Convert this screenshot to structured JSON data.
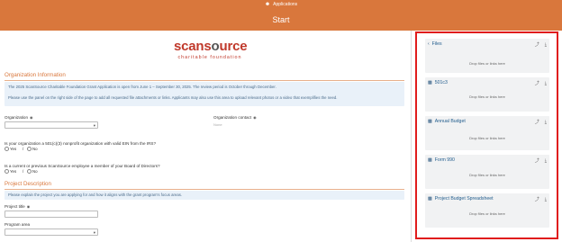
{
  "header": {
    "nav_icon": "users-icon",
    "nav_label": "Applications",
    "title": "Start"
  },
  "logo": {
    "main_part1": "scans",
    "main_o": "o",
    "main_part2": "urce",
    "sub": "charitable foundation"
  },
  "org_info": {
    "title": "Organization Information",
    "info_line1": "The 2025 ScanSource Charitable Foundation Grant Application is open from June 1 – September 30, 2025. The review period is October through December.",
    "info_line2": "Please use the panel on the right side of the page to add all requested file attachments or links. Applicants may also use this area to upload relevant photos or a video that exemplifies the need."
  },
  "fields": {
    "organization_label": "Organization",
    "organization_contact_label": "Organization contact",
    "organization_contact_placeholder": "None",
    "q_501c3": "Is your organization a 501(c)(3) nonprofit organization with valid EIN from the IRS?",
    "q_employee": "Is a current or previous ScanSource employee a member of your Board of Directors?",
    "yes_label": "Yes",
    "no_label": "No",
    "slash": "/"
  },
  "project": {
    "title": "Project Description",
    "info": "Please explain the project you are applying for and how it aligns with the grant program's focus areas.",
    "project_title_label": "Project title",
    "program_area_label": "Program area"
  },
  "files_panel": {
    "files_label": "Files",
    "drop_text": "Drop files or links here",
    "items": [
      {
        "label": "501c3"
      },
      {
        "label": "Annual Budget"
      },
      {
        "label": "Form 990"
      },
      {
        "label": "Project Budget Spreadsheet"
      }
    ]
  },
  "colors": {
    "accent": "#d9773c",
    "highlight_border": "#e01c1c",
    "brand_red": "#c0392b"
  }
}
